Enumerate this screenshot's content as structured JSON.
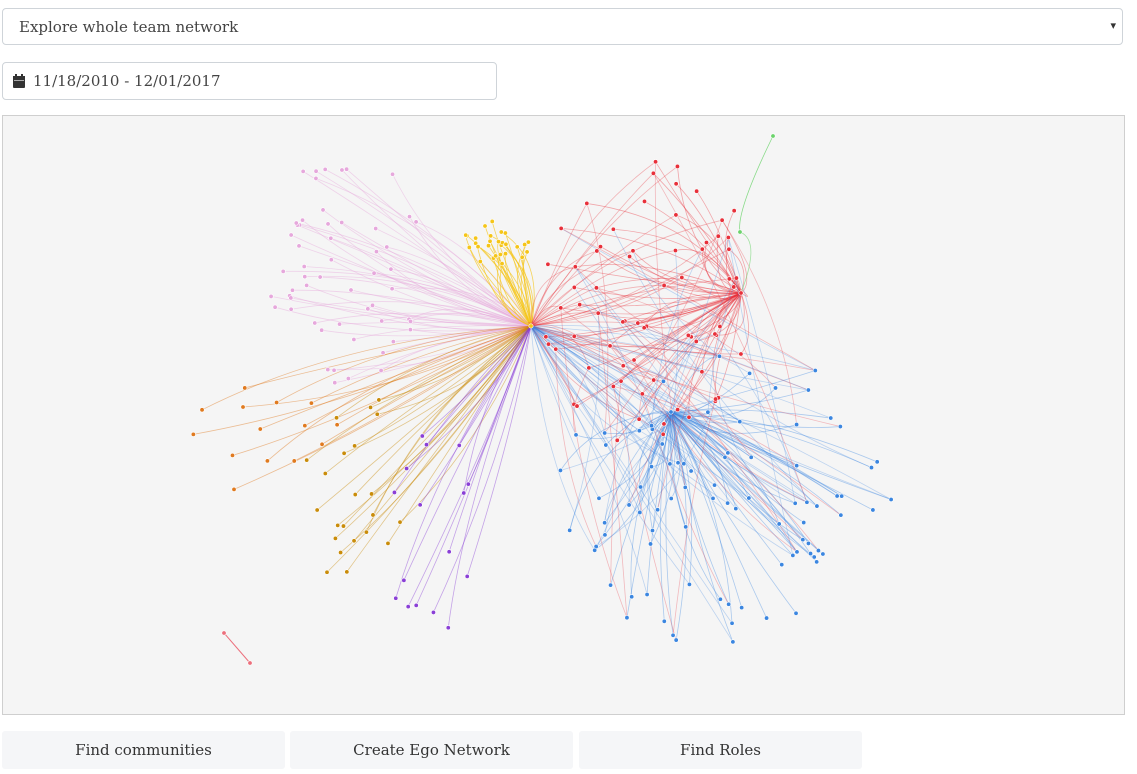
{
  "view_select": {
    "selected": "Explore whole team network",
    "caret": "▾"
  },
  "date_range": {
    "icon": "calendar-icon",
    "value": "11/18/2010 - 12/01/2017"
  },
  "graph": {
    "community_colors": {
      "pink": "#e6a8dc",
      "yellow": "#f5c518",
      "orange": "#e07a1f",
      "red": "#e8303a",
      "blue": "#3b86e0",
      "purple": "#8a3fd6",
      "gold": "#c98c0a",
      "green": "#6bd36b",
      "rose": "#ec6f7c"
    }
  },
  "actions": {
    "find_communities": "Find communities",
    "create_ego_network": "Create Ego Network",
    "find_roles": "Find Roles"
  }
}
